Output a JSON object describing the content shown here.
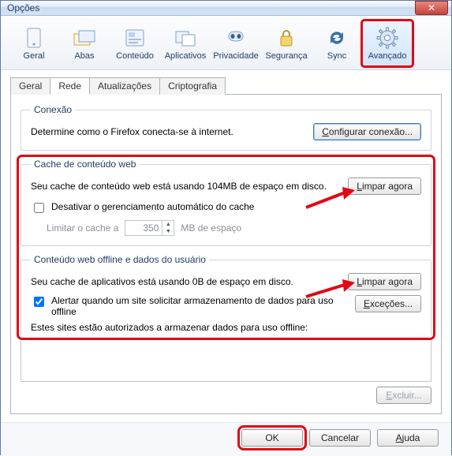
{
  "window": {
    "title": "Opções"
  },
  "toolbar": {
    "items": [
      {
        "label": "Geral"
      },
      {
        "label": "Abas"
      },
      {
        "label": "Conteúdo"
      },
      {
        "label": "Aplicativos"
      },
      {
        "label": "Privacidade"
      },
      {
        "label": "Segurança"
      },
      {
        "label": "Sync"
      },
      {
        "label": "Avançado"
      }
    ]
  },
  "tabs": {
    "items": [
      {
        "label": "Geral"
      },
      {
        "label": "Rede"
      },
      {
        "label": "Atualizações"
      },
      {
        "label": "Criptografia"
      }
    ]
  },
  "connection": {
    "legend": "Conexão",
    "desc": "Determine como o Firefox conecta-se à internet.",
    "configure_prefix": "C",
    "configure_rest": "onfigurar conexão..."
  },
  "webcache": {
    "legend": "Cache de conteúdo web",
    "status": "Seu cache de conteúdo web está usando 104MB de espaço em disco.",
    "clear_prefix": "L",
    "clear_rest": "impar agora",
    "disable_auto": "Desativar o gerenciamento automático do cache",
    "limit_label": "Limitar o cache a",
    "limit_value": "350",
    "limit_suffix": "MB de espaço"
  },
  "offline": {
    "legend": "Conteúdo web offline e dados do usuário",
    "status": "Seu cache de aplicativos está usando 0B de espaço em disco.",
    "clear_prefix": "L",
    "clear_rest": "impar agora",
    "alert": "Alertar quando um site solicitar armazenamento de dados para uso offline",
    "exceptions_prefix": "E",
    "exceptions_rest": "xceções...",
    "sites_label": "Estes sites estão autorizados a armazenar dados para uso offline:",
    "exclude_prefix": "E",
    "exclude_rest": "xcluir..."
  },
  "footer": {
    "ok": "OK",
    "cancel": "Cancelar",
    "help_prefix": "A",
    "help_rest": "juda"
  }
}
